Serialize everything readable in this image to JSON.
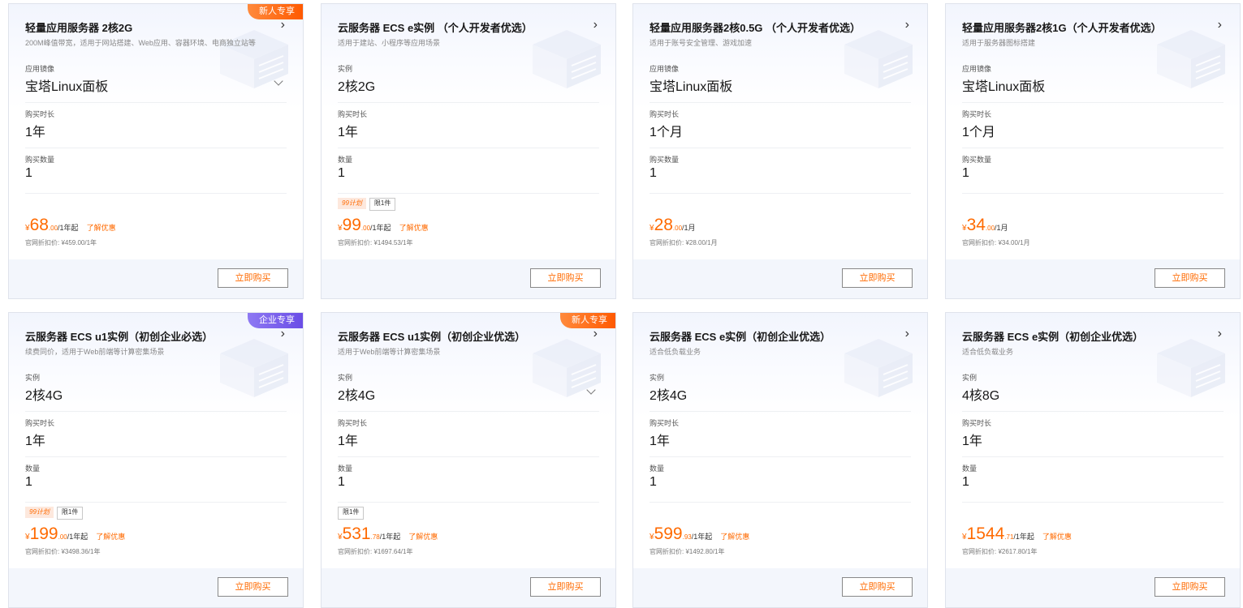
{
  "buy_label": "立即购买",
  "learn_label": "了解优惠",
  "colors": {
    "accent": "#ff6a00",
    "ribbon_new": "#ff6a00",
    "ribbon_enterprise": "#7b61ff"
  },
  "cards": [
    {
      "title": "轻量应用服务器 2核2G",
      "ribbon": "新人专享",
      "ribbon_type": "newbie",
      "desc": "200M峰值带宽，适用于网站搭建、Web应用、容器环境、电商独立站等",
      "fields": [
        {
          "label": "应用镜像",
          "value": "宝塔Linux面板",
          "dropdown": true
        },
        {
          "label": "购买时长",
          "value": "1年"
        },
        {
          "label": "购买数量",
          "value": "1"
        }
      ],
      "tags": [],
      "price": {
        "symbol": "¥",
        "amount": "68",
        "decimal": ".00",
        "unit": "/1年起"
      },
      "original": "官网折扣价: ¥459.00/1年"
    },
    {
      "title": "云服务器 ECS e实例 （个人开发者优选）",
      "ribbon": "",
      "ribbon_type": "",
      "desc": "适用于建站、小程序等应用场景",
      "fields": [
        {
          "label": "实例",
          "value": "2核2G"
        },
        {
          "label": "购买时长",
          "value": "1年"
        },
        {
          "label": "数量",
          "value": "1"
        }
      ],
      "tags": [
        {
          "text": "99计划",
          "type": "plan"
        },
        {
          "text": "限1件",
          "type": "limit"
        }
      ],
      "price": {
        "symbol": "¥",
        "amount": "99",
        "decimal": ".00",
        "unit": "/1年起"
      },
      "original": "官网折扣价: ¥1494.53/1年"
    },
    {
      "title": "轻量应用服务器2核0.5G （个人开发者优选）",
      "ribbon": "",
      "ribbon_type": "",
      "desc": "适用于账号安全管理、游戏加速",
      "fields": [
        {
          "label": "应用镜像",
          "value": "宝塔Linux面板"
        },
        {
          "label": "购买时长",
          "value": "1个月"
        },
        {
          "label": "购买数量",
          "value": "1"
        }
      ],
      "tags": [],
      "price": {
        "symbol": "¥",
        "amount": "28",
        "decimal": ".00",
        "unit": "/1月"
      },
      "original": "官网折扣价: ¥28.00/1月"
    },
    {
      "title": "轻量应用服务器2核1G（个人开发者优选）",
      "ribbon": "",
      "ribbon_type": "",
      "desc": "适用于服务器图标搭建",
      "fields": [
        {
          "label": "应用镜像",
          "value": "宝塔Linux面板"
        },
        {
          "label": "购买时长",
          "value": "1个月"
        },
        {
          "label": "购买数量",
          "value": "1"
        }
      ],
      "tags": [],
      "price": {
        "symbol": "¥",
        "amount": "34",
        "decimal": ".00",
        "unit": "/1月"
      },
      "original": "官网折扣价: ¥34.00/1月"
    },
    {
      "title": "云服务器 ECS u1实例（初创企业必选）",
      "ribbon": "企业专享",
      "ribbon_type": "enterprise",
      "desc": "续费同价，适用于Web前端等计算密集场景",
      "fields": [
        {
          "label": "实例",
          "value": "2核4G"
        },
        {
          "label": "购买时长",
          "value": "1年"
        },
        {
          "label": "数量",
          "value": "1"
        }
      ],
      "tags": [
        {
          "text": "99计划",
          "type": "plan"
        },
        {
          "text": "限1件",
          "type": "limit"
        }
      ],
      "price": {
        "symbol": "¥",
        "amount": "199",
        "decimal": ".00",
        "unit": "/1年起"
      },
      "original": "官网折扣价: ¥3498.36/1年"
    },
    {
      "title": "云服务器 ECS u1实例（初创企业优选）",
      "ribbon": "新人专享",
      "ribbon_type": "newbie",
      "desc": "适用于Web前端等计算密集场景",
      "fields": [
        {
          "label": "实例",
          "value": "2核4G",
          "dropdown": true
        },
        {
          "label": "购买时长",
          "value": "1年"
        },
        {
          "label": "数量",
          "value": "1"
        }
      ],
      "tags": [
        {
          "text": "限1件",
          "type": "limit"
        }
      ],
      "price": {
        "symbol": "¥",
        "amount": "531",
        "decimal": ".78",
        "unit": "/1年起"
      },
      "original": "官网折扣价: ¥1697.64/1年"
    },
    {
      "title": "云服务器 ECS e实例（初创企业优选）",
      "ribbon": "",
      "ribbon_type": "",
      "desc": "适合低负载业务",
      "fields": [
        {
          "label": "实例",
          "value": "2核4G"
        },
        {
          "label": "购买时长",
          "value": "1年"
        },
        {
          "label": "数量",
          "value": "1"
        }
      ],
      "tags": [],
      "price": {
        "symbol": "¥",
        "amount": "599",
        "decimal": ".93",
        "unit": "/1年起"
      },
      "original": "官网折扣价: ¥1492.80/1年"
    },
    {
      "title": "云服务器 ECS e实例（初创企业优选）",
      "ribbon": "",
      "ribbon_type": "",
      "desc": "适合低负载业务",
      "fields": [
        {
          "label": "实例",
          "value": "4核8G"
        },
        {
          "label": "购买时长",
          "value": "1年"
        },
        {
          "label": "数量",
          "value": "1"
        }
      ],
      "tags": [],
      "price": {
        "symbol": "¥",
        "amount": "1544",
        "decimal": ".71",
        "unit": "/1年起"
      },
      "original": "官网折扣价: ¥2617.80/1年"
    }
  ]
}
